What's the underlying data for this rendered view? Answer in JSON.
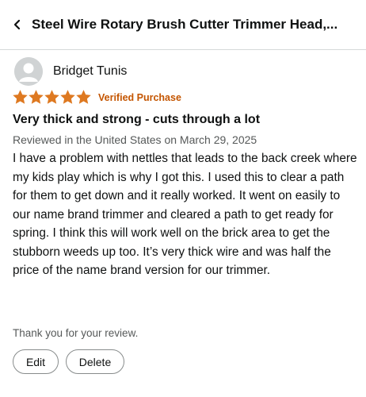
{
  "header": {
    "title": "Steel Wire Rotary Brush Cutter Trimmer Head,...",
    "back_icon": "chevron-left-icon"
  },
  "review": {
    "reviewer_name": "Bridget Tunis",
    "avatar_icon": "person-icon",
    "rating": 5,
    "rating_max": 5,
    "star_color": "#de7921",
    "verified_label": "Verified Purchase",
    "verified_color": "#c45500",
    "title": "Very thick and strong - cuts through a lot",
    "meta": "Reviewed in the United States on March 29, 2025",
    "body": "I have a problem with nettles that leads to the back creek where my kids play which is why I got this. I used this to clear a path for them to get down and it really worked. It went on easily to our name brand trimmer and cleared a path to get ready for spring. I think this will work well on the brick area to get the stubborn weeds up too. It’s very thick wire and was half the price of the name brand version for our trimmer."
  },
  "footer": {
    "thanks_text": "Thank you for your review.",
    "edit_label": "Edit",
    "delete_label": "Delete"
  }
}
